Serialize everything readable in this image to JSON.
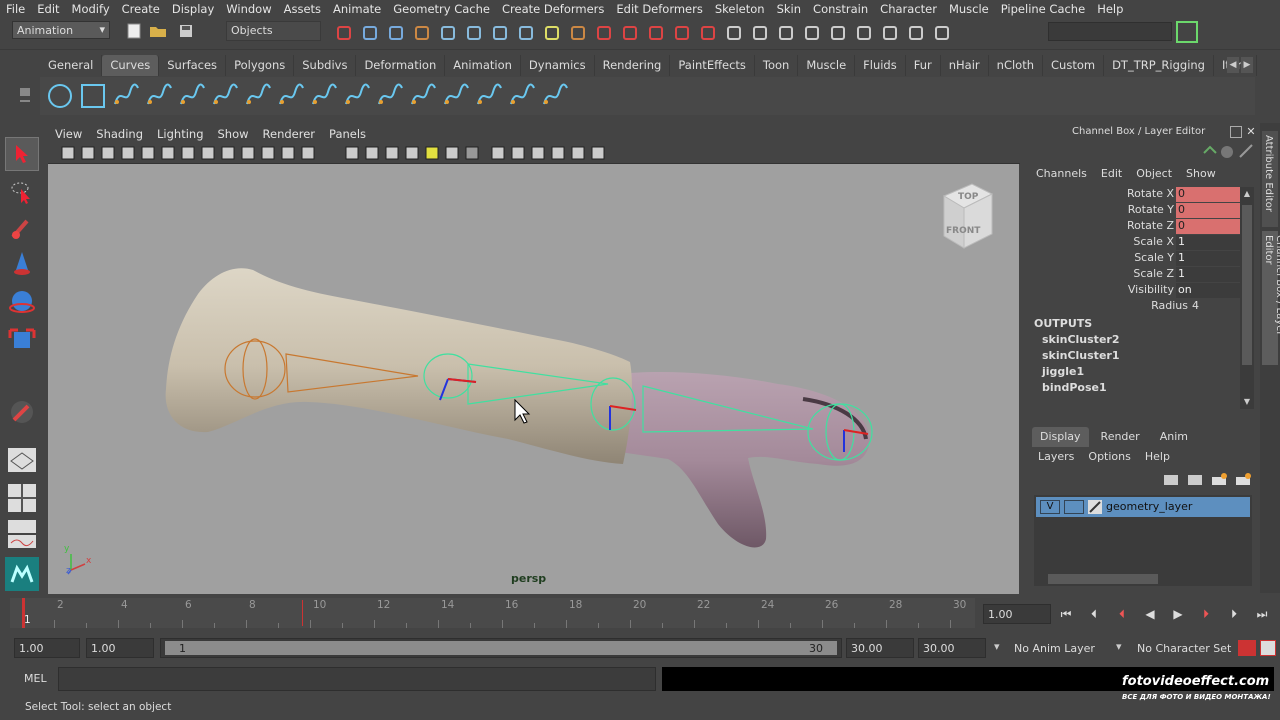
{
  "menubar": [
    "File",
    "Edit",
    "Modify",
    "Create",
    "Display",
    "Window",
    "Assets",
    "Animate",
    "Geometry Cache",
    "Create Deformers",
    "Edit Deformers",
    "Skeleton",
    "Skin",
    "Constrain",
    "Character",
    "Muscle",
    "Pipeline Cache",
    "Help"
  ],
  "status": {
    "mode": "Animation",
    "selection_mask": "Objects"
  },
  "shelf_tabs": [
    "General",
    "Curves",
    "Surfaces",
    "Polygons",
    "Subdivs",
    "Deformation",
    "Animation",
    "Dynamics",
    "Rendering",
    "PaintEffects",
    "Toon",
    "Muscle",
    "Fluids",
    "Fur",
    "nHair",
    "nCloth",
    "Custom",
    "DT_TRP_Rigging",
    "Item"
  ],
  "shelf_active": "Curves",
  "viewport": {
    "menu": [
      "View",
      "Shading",
      "Lighting",
      "Show",
      "Renderer",
      "Panels"
    ],
    "camera_label": "persp",
    "viewcube": {
      "top": "TOP",
      "front": "FRONT"
    },
    "axis": {
      "y": "y",
      "x": "x",
      "z": "z"
    }
  },
  "channel_box": {
    "title": "Channel Box / Layer Editor",
    "menu": [
      "Channels",
      "Edit",
      "Object",
      "Show"
    ],
    "attributes": [
      {
        "label": "Rotate X",
        "value": "0",
        "keyed": true
      },
      {
        "label": "Rotate Y",
        "value": "0",
        "keyed": true
      },
      {
        "label": "Rotate Z",
        "value": "0",
        "keyed": true
      },
      {
        "label": "Scale X",
        "value": "1",
        "keyed": false
      },
      {
        "label": "Scale Y",
        "value": "1",
        "keyed": false
      },
      {
        "label": "Scale Z",
        "value": "1",
        "keyed": false
      },
      {
        "label": "Visibility",
        "value": "on",
        "keyed": false
      },
      {
        "label": "Radius",
        "value": "4",
        "keyed": false
      }
    ],
    "outputs_header": "OUTPUTS",
    "outputs": [
      "skinCluster2",
      "skinCluster1",
      "jiggle1",
      "bindPose1"
    ]
  },
  "layer_editor": {
    "tabs": [
      "Display",
      "Render",
      "Anim"
    ],
    "active_tab": "Display",
    "menu": [
      "Layers",
      "Options",
      "Help"
    ],
    "layer": {
      "visible": "V",
      "name": "geometry_layer"
    }
  },
  "vertical_tabs": [
    "Attribute Editor",
    "Channel Box / Layer Editor"
  ],
  "timeline": {
    "labels": [
      "2",
      "4",
      "6",
      "8",
      "10",
      "12",
      "14",
      "16",
      "18",
      "20",
      "22",
      "24",
      "26",
      "28",
      "30"
    ],
    "start_label": "1",
    "current_frame": "1.00"
  },
  "range": {
    "start": "1.00",
    "playback_start": "1.00",
    "slider_start": "1",
    "slider_end": "30",
    "playback_end": "30.00",
    "end": "30.00",
    "anim_layer": "No Anim Layer",
    "character_set": "No Character Set"
  },
  "command": {
    "label": "MEL"
  },
  "helpline": "Select Tool: select an object",
  "watermark": {
    "site": "fotovideoeffect.com",
    "tagline": "ВСЕ ДЛЯ ФОТО И ВИДЕО МОНТАЖА!"
  },
  "colors": {
    "accent": "#5d8fbf",
    "keyed": "#d9706f",
    "joint": "#40e0a0",
    "bone": "#c87830"
  }
}
